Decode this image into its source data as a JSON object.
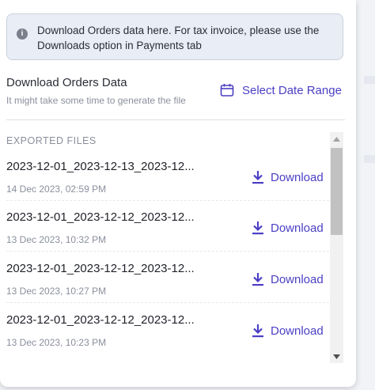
{
  "info_banner": {
    "text": "Download Orders data here. For tax invoice, please use the Downloads option in Payments tab"
  },
  "orders_section": {
    "title": "Download Orders Data",
    "subtitle": "It might take some time to generate the file",
    "date_range_label": "Select Date Range"
  },
  "exported": {
    "header": "EXPORTED FILES",
    "files": [
      {
        "name": "2023-12-01_2023-12-13_2023-12...",
        "date": "14 Dec 2023, 02:59 PM",
        "action": "Download"
      },
      {
        "name": "2023-12-01_2023-12-12_2023-12...",
        "date": "13 Dec 2023, 10:32 PM",
        "action": "Download"
      },
      {
        "name": "2023-12-01_2023-12-12_2023-12...",
        "date": "13 Dec 2023, 10:27 PM",
        "action": "Download"
      },
      {
        "name": "2023-12-01_2023-12-12_2023-12...",
        "date": "13 Dec 2023, 10:23 PM",
        "action": "Download"
      }
    ]
  },
  "colors": {
    "accent": "#4b3fc4",
    "banner_bg": "#e9edf5",
    "muted_text": "#8a8f9c"
  },
  "icons": {
    "info": "info-icon",
    "calendar": "calendar-icon",
    "download": "download-icon"
  }
}
